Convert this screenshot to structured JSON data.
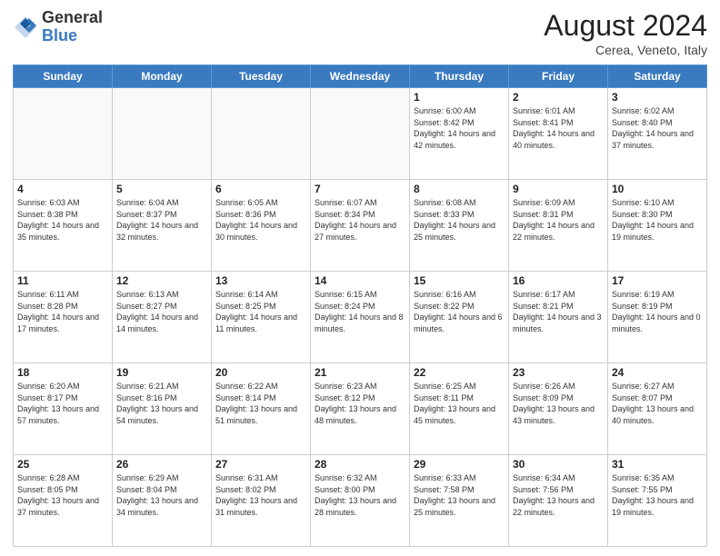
{
  "header": {
    "logo_general": "General",
    "logo_blue": "Blue",
    "title": "August 2024",
    "location": "Cerea, Veneto, Italy"
  },
  "days_of_week": [
    "Sunday",
    "Monday",
    "Tuesday",
    "Wednesday",
    "Thursday",
    "Friday",
    "Saturday"
  ],
  "weeks": [
    [
      {
        "day": "",
        "empty": true
      },
      {
        "day": "",
        "empty": true
      },
      {
        "day": "",
        "empty": true
      },
      {
        "day": "",
        "empty": true
      },
      {
        "day": "1",
        "info": "Sunrise: 6:00 AM\nSunset: 8:42 PM\nDaylight: 14 hours\nand 42 minutes."
      },
      {
        "day": "2",
        "info": "Sunrise: 6:01 AM\nSunset: 8:41 PM\nDaylight: 14 hours\nand 40 minutes."
      },
      {
        "day": "3",
        "info": "Sunrise: 6:02 AM\nSunset: 8:40 PM\nDaylight: 14 hours\nand 37 minutes."
      }
    ],
    [
      {
        "day": "4",
        "info": "Sunrise: 6:03 AM\nSunset: 8:38 PM\nDaylight: 14 hours\nand 35 minutes."
      },
      {
        "day": "5",
        "info": "Sunrise: 6:04 AM\nSunset: 8:37 PM\nDaylight: 14 hours\nand 32 minutes."
      },
      {
        "day": "6",
        "info": "Sunrise: 6:05 AM\nSunset: 8:36 PM\nDaylight: 14 hours\nand 30 minutes."
      },
      {
        "day": "7",
        "info": "Sunrise: 6:07 AM\nSunset: 8:34 PM\nDaylight: 14 hours\nand 27 minutes."
      },
      {
        "day": "8",
        "info": "Sunrise: 6:08 AM\nSunset: 8:33 PM\nDaylight: 14 hours\nand 25 minutes."
      },
      {
        "day": "9",
        "info": "Sunrise: 6:09 AM\nSunset: 8:31 PM\nDaylight: 14 hours\nand 22 minutes."
      },
      {
        "day": "10",
        "info": "Sunrise: 6:10 AM\nSunset: 8:30 PM\nDaylight: 14 hours\nand 19 minutes."
      }
    ],
    [
      {
        "day": "11",
        "info": "Sunrise: 6:11 AM\nSunset: 8:28 PM\nDaylight: 14 hours\nand 17 minutes."
      },
      {
        "day": "12",
        "info": "Sunrise: 6:13 AM\nSunset: 8:27 PM\nDaylight: 14 hours\nand 14 minutes."
      },
      {
        "day": "13",
        "info": "Sunrise: 6:14 AM\nSunset: 8:25 PM\nDaylight: 14 hours\nand 11 minutes."
      },
      {
        "day": "14",
        "info": "Sunrise: 6:15 AM\nSunset: 8:24 PM\nDaylight: 14 hours\nand 8 minutes."
      },
      {
        "day": "15",
        "info": "Sunrise: 6:16 AM\nSunset: 8:22 PM\nDaylight: 14 hours\nand 6 minutes."
      },
      {
        "day": "16",
        "info": "Sunrise: 6:17 AM\nSunset: 8:21 PM\nDaylight: 14 hours\nand 3 minutes."
      },
      {
        "day": "17",
        "info": "Sunrise: 6:19 AM\nSunset: 8:19 PM\nDaylight: 14 hours\nand 0 minutes."
      }
    ],
    [
      {
        "day": "18",
        "info": "Sunrise: 6:20 AM\nSunset: 8:17 PM\nDaylight: 13 hours\nand 57 minutes."
      },
      {
        "day": "19",
        "info": "Sunrise: 6:21 AM\nSunset: 8:16 PM\nDaylight: 13 hours\nand 54 minutes."
      },
      {
        "day": "20",
        "info": "Sunrise: 6:22 AM\nSunset: 8:14 PM\nDaylight: 13 hours\nand 51 minutes."
      },
      {
        "day": "21",
        "info": "Sunrise: 6:23 AM\nSunset: 8:12 PM\nDaylight: 13 hours\nand 48 minutes."
      },
      {
        "day": "22",
        "info": "Sunrise: 6:25 AM\nSunset: 8:11 PM\nDaylight: 13 hours\nand 45 minutes."
      },
      {
        "day": "23",
        "info": "Sunrise: 6:26 AM\nSunset: 8:09 PM\nDaylight: 13 hours\nand 43 minutes."
      },
      {
        "day": "24",
        "info": "Sunrise: 6:27 AM\nSunset: 8:07 PM\nDaylight: 13 hours\nand 40 minutes."
      }
    ],
    [
      {
        "day": "25",
        "info": "Sunrise: 6:28 AM\nSunset: 8:05 PM\nDaylight: 13 hours\nand 37 minutes."
      },
      {
        "day": "26",
        "info": "Sunrise: 6:29 AM\nSunset: 8:04 PM\nDaylight: 13 hours\nand 34 minutes."
      },
      {
        "day": "27",
        "info": "Sunrise: 6:31 AM\nSunset: 8:02 PM\nDaylight: 13 hours\nand 31 minutes."
      },
      {
        "day": "28",
        "info": "Sunrise: 6:32 AM\nSunset: 8:00 PM\nDaylight: 13 hours\nand 28 minutes."
      },
      {
        "day": "29",
        "info": "Sunrise: 6:33 AM\nSunset: 7:58 PM\nDaylight: 13 hours\nand 25 minutes."
      },
      {
        "day": "30",
        "info": "Sunrise: 6:34 AM\nSunset: 7:56 PM\nDaylight: 13 hours\nand 22 minutes."
      },
      {
        "day": "31",
        "info": "Sunrise: 6:35 AM\nSunset: 7:55 PM\nDaylight: 13 hours\nand 19 minutes."
      }
    ]
  ]
}
